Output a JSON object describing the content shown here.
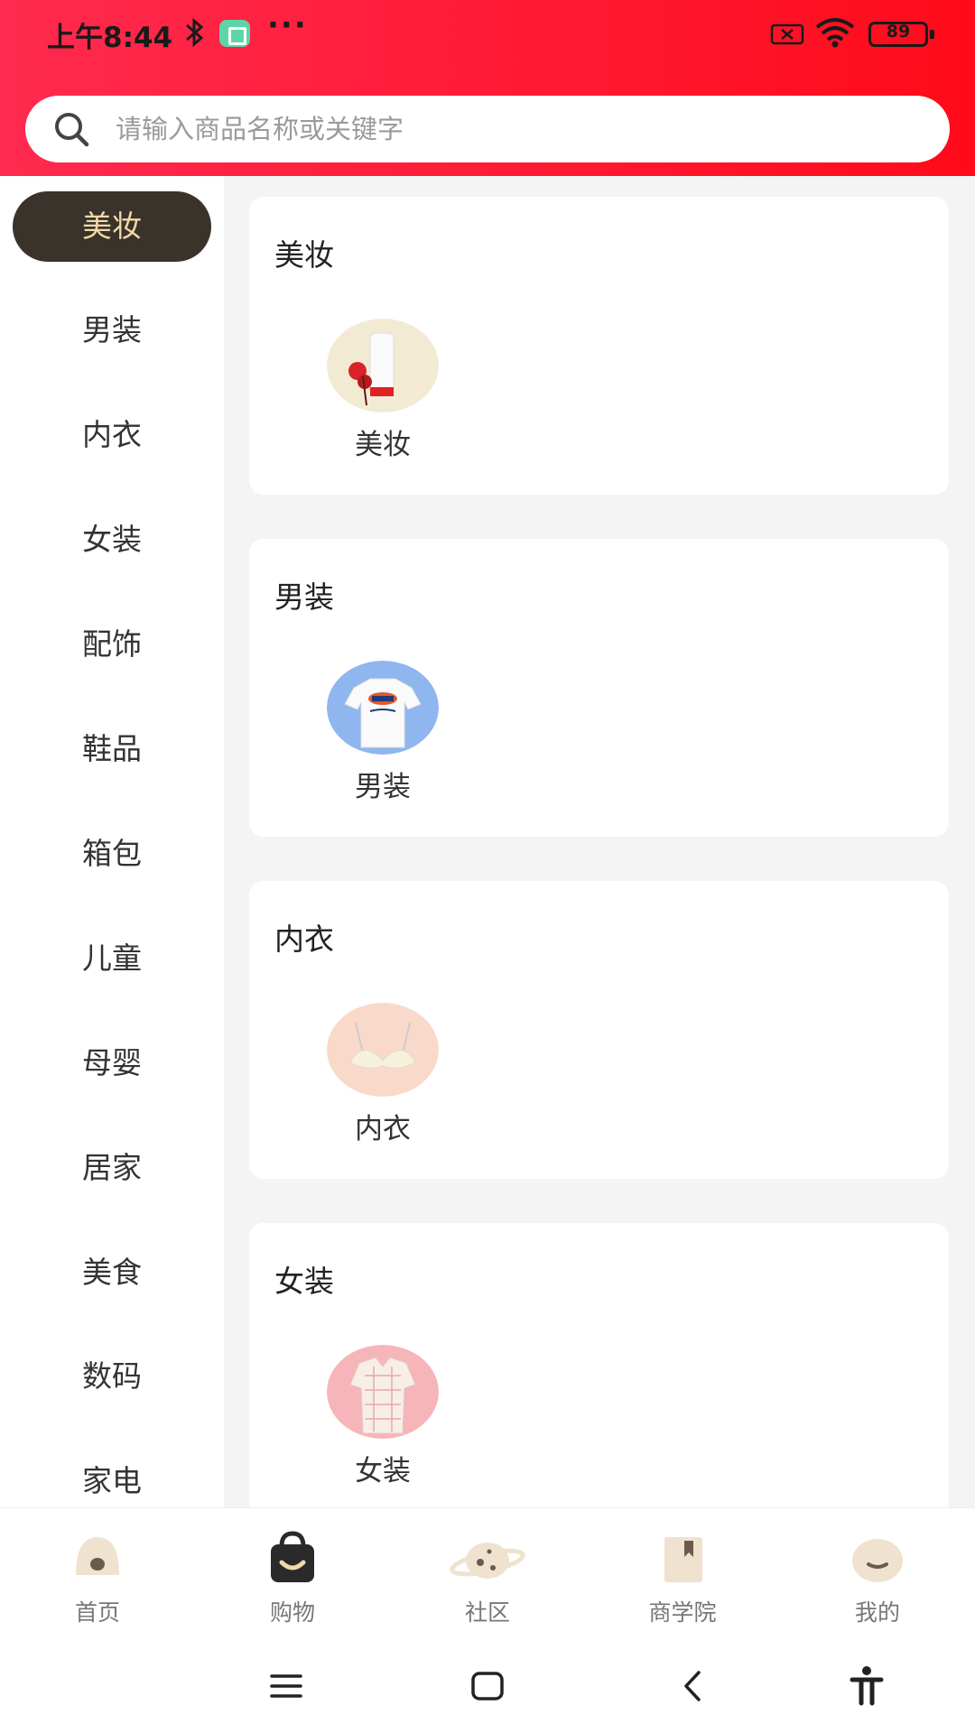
{
  "status_bar": {
    "time": "上午8:44",
    "battery": "89"
  },
  "search": {
    "placeholder": "请输入商品名称或关键字"
  },
  "sidebar": {
    "items": [
      {
        "label": "美妆",
        "active": true
      },
      {
        "label": "男装"
      },
      {
        "label": "内衣"
      },
      {
        "label": "女装"
      },
      {
        "label": "配饰"
      },
      {
        "label": "鞋品"
      },
      {
        "label": "箱包"
      },
      {
        "label": "儿童"
      },
      {
        "label": "母婴"
      },
      {
        "label": "居家"
      },
      {
        "label": "美食"
      },
      {
        "label": "数码"
      },
      {
        "label": "家电"
      }
    ]
  },
  "sections": [
    {
      "title": "美妆",
      "item_label": "美妆",
      "thumb_color": "#f3ead3"
    },
    {
      "title": "男装",
      "item_label": "男装",
      "thumb_color": "#8fb6ef"
    },
    {
      "title": "内衣",
      "item_label": "内衣",
      "thumb_color": "#f9d9c9"
    },
    {
      "title": "女装",
      "item_label": "女装",
      "thumb_color": "#f6b5b9"
    }
  ],
  "tabbar": {
    "tabs": [
      {
        "label": "首页",
        "icon": "home-icon"
      },
      {
        "label": "购物",
        "icon": "shopping-bag-icon",
        "active": true
      },
      {
        "label": "社区",
        "icon": "planet-icon"
      },
      {
        "label": "商学院",
        "icon": "book-icon"
      },
      {
        "label": "我的",
        "icon": "profile-icon"
      }
    ]
  },
  "colors": {
    "header_red": "#ff1a33",
    "active_bg": "#3a332c",
    "active_text": "#f3d9a8"
  }
}
